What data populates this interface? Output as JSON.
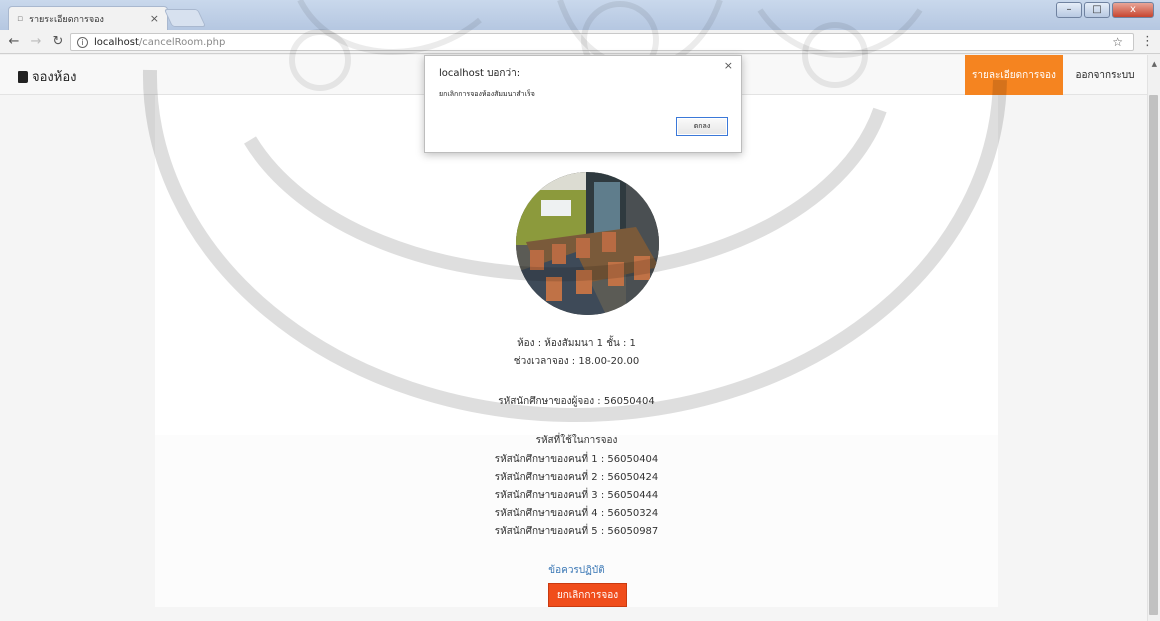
{
  "browser": {
    "tab_title": "รายระเอียดการจอง",
    "tab_close": "×",
    "url_host": "localhost",
    "url_path": "/cancelRoom.php",
    "win_min": "–",
    "win_max": "□",
    "win_close": "x"
  },
  "navbar": {
    "brand": "จองห้อง",
    "detail_link": "รายละเอียดการจอง",
    "logout_link": "ออกจากระบบ",
    "accent_color": "#f58420"
  },
  "booking": {
    "room_line": "ห้อง : ห้องสัมมนา 1 ชั้น : 1",
    "time_line": "ช่วงเวลาจอง : 18.00-20.00",
    "booker_line": "รหัสนักศึกษาของผู้จอง : 56050404",
    "codes_heading": "รหัสที่ใช้ในการจอง",
    "members": [
      "รหัสนักศึกษาของคนที่ 1 : 56050404",
      "รหัสนักศึกษาของคนที่ 2 : 56050424",
      "รหัสนักศึกษาของคนที่ 3 : 56050444",
      "รหัสนักศึกษาของคนที่ 4 : 56050324",
      "รหัสนักศึกษาของคนที่ 5 : 56050987"
    ],
    "rules_link": "ข้อควรปฏิบัติ",
    "cancel_button": "ยกเลิกการจอง"
  },
  "dialog": {
    "title": "localhost บอกว่า:",
    "message": "ยกเลิกการจองห้องสัมมนาสำเร็จ",
    "ok_button": "ตกลง",
    "close": "×"
  },
  "icons": [
    "back-arrow-icon",
    "forward-arrow-icon",
    "reload-icon",
    "info-icon",
    "star-icon",
    "menu-icon",
    "book-icon",
    "close-icon"
  ]
}
